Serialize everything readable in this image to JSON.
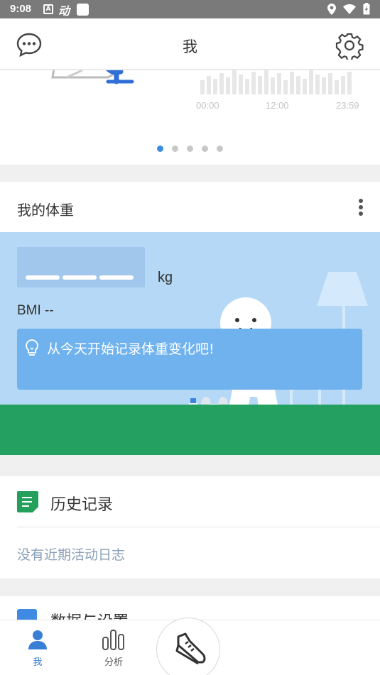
{
  "status_bar": {
    "time": "9:08",
    "app_icon_text": "A",
    "app_name_glyph": "动"
  },
  "header": {
    "title": "我"
  },
  "carousel": {
    "ticks": [
      "00:00",
      "12:00",
      "23:59"
    ],
    "page_count": 5,
    "active_page": 1
  },
  "weight": {
    "title": "我的体重",
    "unit": "kg",
    "bmi": "BMI --",
    "tip": "从今天开始记录体重变化吧!"
  },
  "history": {
    "title": "历史记录",
    "empty_text": "没有近期活动日志"
  },
  "settings": {
    "title": "数据与设置"
  },
  "tabs": [
    {
      "label": "我",
      "icon": "person-icon",
      "active": true
    },
    {
      "label": "分析",
      "icon": "bar-chart-icon",
      "active": false
    }
  ],
  "colors": {
    "accent": "#3a8de0",
    "sky": "#b4d8f5",
    "ground": "#24a160",
    "tip": "#6fb2ee"
  }
}
